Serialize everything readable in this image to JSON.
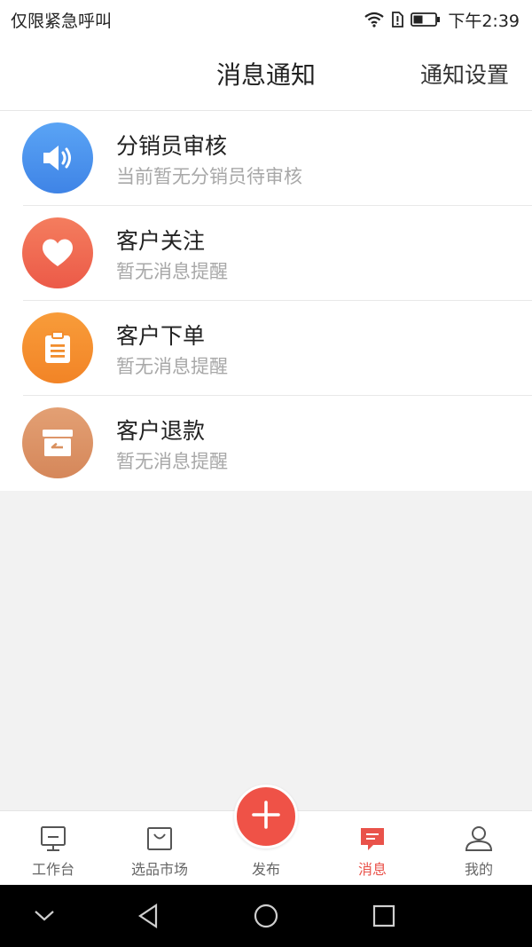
{
  "status_bar": {
    "carrier_text": "仅限紧急呼叫",
    "time": "下午2:39",
    "icons": [
      "wifi-icon",
      "sim-alert-icon",
      "battery-icon"
    ]
  },
  "header": {
    "title": "消息通知",
    "action_label": "通知设置"
  },
  "notifications": [
    {
      "title": "分销员审核",
      "subtitle": "当前暂无分销员待审核",
      "icon": "speaker-icon",
      "color": "#4a90ee"
    },
    {
      "title": "客户关注",
      "subtitle": "暂无消息提醒",
      "icon": "heart-icon",
      "color": "#f06a52"
    },
    {
      "title": "客户下单",
      "subtitle": "暂无消息提醒",
      "icon": "clipboard-icon",
      "color": "#f59030"
    },
    {
      "title": "客户退款",
      "subtitle": "暂无消息提醒",
      "icon": "refund-box-icon",
      "color": "#d9915f"
    }
  ],
  "tabbar": {
    "items": [
      {
        "label": "工作台",
        "icon": "monitor-icon"
      },
      {
        "label": "选品市场",
        "icon": "shopping-bag-icon"
      },
      {
        "label": "发布",
        "icon": "plus-icon"
      },
      {
        "label": "消息",
        "icon": "message-icon",
        "active": true
      },
      {
        "label": "我的",
        "icon": "user-icon"
      }
    ]
  },
  "colors": {
    "accent": "#ef5247",
    "active_tab": "#e9524a",
    "page_background": "#f2f2f2"
  },
  "system_nav": [
    "chevron-down-icon",
    "back-icon",
    "home-icon",
    "recents-icon"
  ]
}
